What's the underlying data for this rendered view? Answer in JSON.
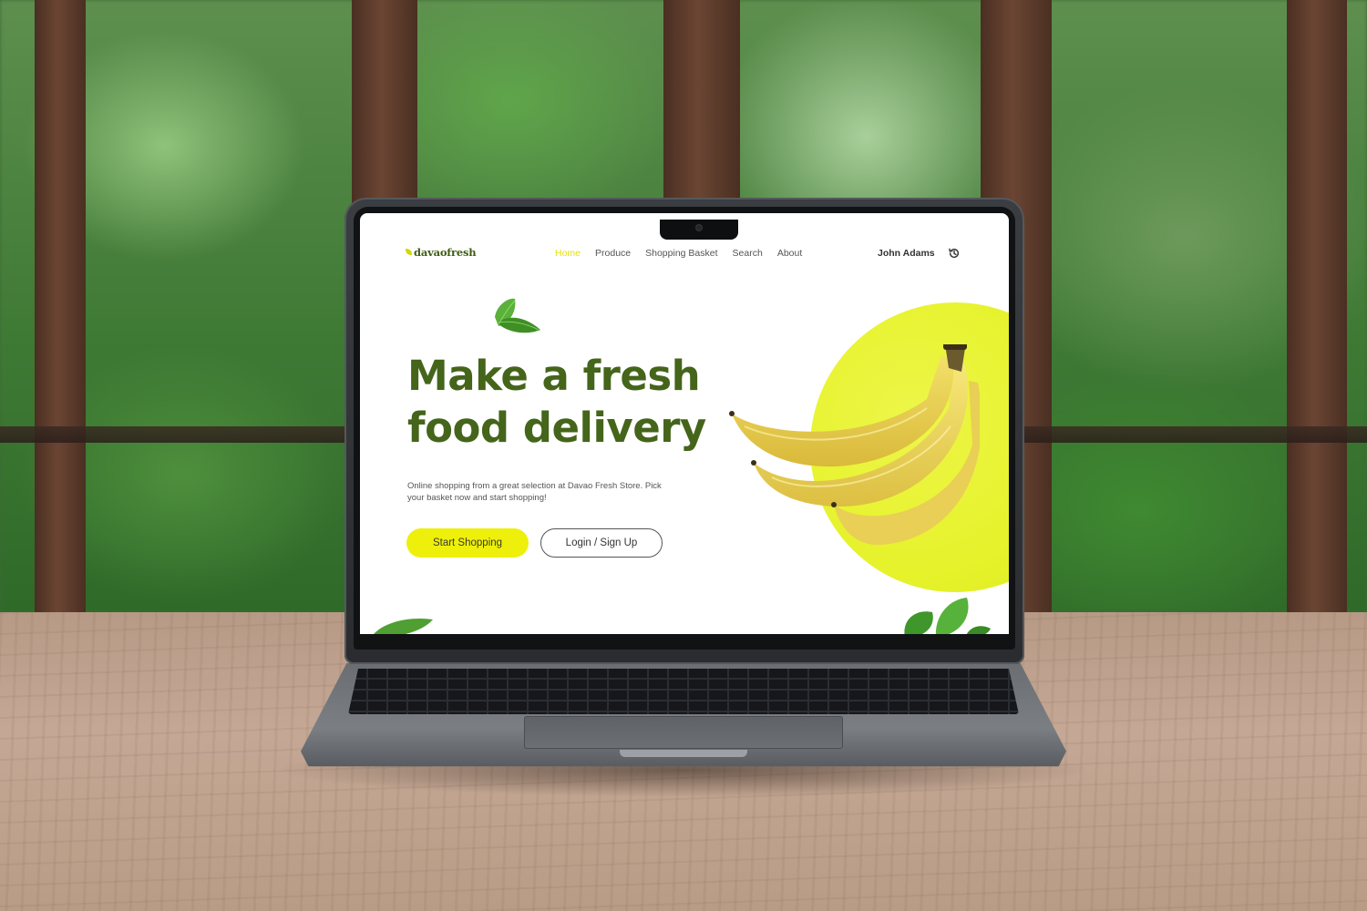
{
  "site": {
    "logo_text": "davaofresh",
    "nav": {
      "items": [
        {
          "label": "Home",
          "active": true
        },
        {
          "label": "Produce",
          "active": false
        },
        {
          "label": "Shopping Basket",
          "active": false
        },
        {
          "label": "Search",
          "active": false
        },
        {
          "label": "About",
          "active": false
        }
      ],
      "user_name": "John Adams",
      "user_icon": "history-icon"
    },
    "hero": {
      "headline_line1": "Make a fresh",
      "headline_line2": "food delivery",
      "subtext": "Online shopping from a great selection at Davao Fresh Store. Pick your basket now and start shopping!",
      "primary_button": "Start Shopping",
      "secondary_button": "Login / Sign Up",
      "image_subject": "banana bunch on yellow circle"
    }
  },
  "colors": {
    "accent_yellow": "#eef00c",
    "headline_green": "#44651a",
    "active_nav": "#e5df16"
  }
}
